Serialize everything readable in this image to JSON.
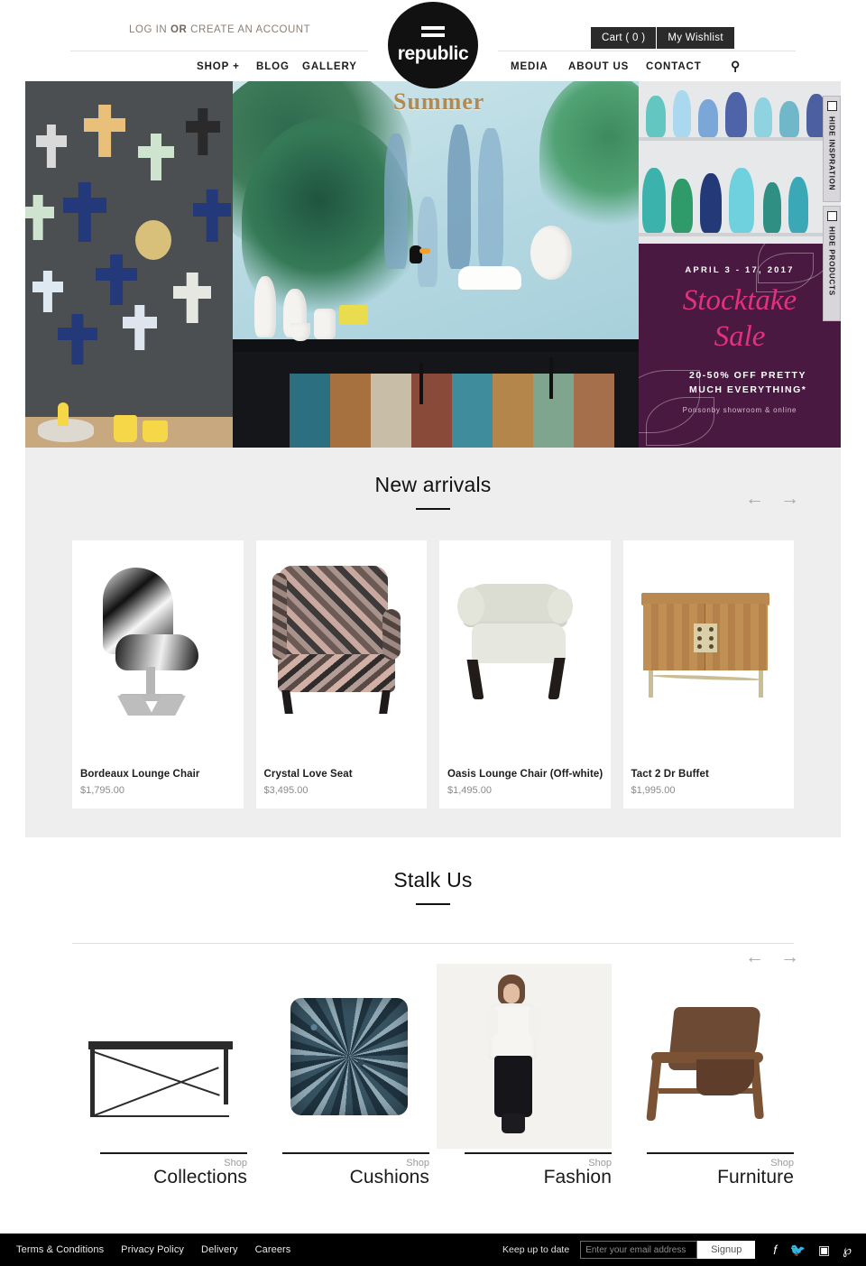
{
  "header": {
    "account": {
      "login": "LOG IN",
      "or": " OR ",
      "create": "CREATE AN ACCOUNT"
    },
    "cart_label": "Cart ( 0 )",
    "wishlist_label": "My Wishlist",
    "logo": {
      "word": "republic",
      "icon": "equals-icon"
    },
    "nav_left": [
      {
        "label": "SHOP +",
        "name": "nav-shop"
      },
      {
        "label": "BLOG",
        "name": "nav-blog"
      },
      {
        "label": "GALLERY",
        "name": "nav-gallery"
      }
    ],
    "nav_right": [
      {
        "label": "MEDIA",
        "name": "nav-media"
      },
      {
        "label": "ABOUT US",
        "name": "nav-about-us"
      },
      {
        "label": "CONTACT",
        "name": "nav-contact"
      }
    ],
    "search_icon": "search-icon"
  },
  "hero": {
    "summer_sign": "Summer",
    "sale": {
      "date": "APRIL 3 - 17, 2017",
      "word1": "Stocktake",
      "word2": "Sale",
      "offer": "20-50% OFF PRETTY\nMUCH EVERYTHING*",
      "offer_line1": "20-50% OFF PRETTY",
      "offer_line2": "MUCH EVERYTHING*",
      "location": "Ponsonby showroom & online"
    },
    "toggles": [
      {
        "label": "HIDE INSPRATION",
        "name": "hide-inspiration"
      },
      {
        "label": "HIDE PRODUCTS",
        "name": "hide-products"
      }
    ]
  },
  "new_arrivals": {
    "title": "New arrivals",
    "prev_arrow": "←",
    "next_arrow": "→",
    "products": [
      {
        "name": "Bordeaux Lounge Chair",
        "price": "$1,795.00"
      },
      {
        "name": "Crystal Love Seat",
        "price": "$3,495.00"
      },
      {
        "name": "Oasis Lounge Chair (Off-white)",
        "price": "$1,495.00"
      },
      {
        "name": "Tact 2 Dr Buffet",
        "price": "$1,995.00"
      }
    ]
  },
  "stalk_us": {
    "title": "Stalk Us",
    "prev_arrow": "←",
    "next_arrow": "→",
    "categories": [
      {
        "shop": "Shop",
        "name": "Collections"
      },
      {
        "shop": "Shop",
        "name": "Cushions"
      },
      {
        "shop": "Shop",
        "name": "Fashion"
      },
      {
        "shop": "Shop",
        "name": "Furniture"
      }
    ]
  },
  "footer": {
    "links": [
      {
        "label": "Terms & Conditions",
        "name": "footer-terms"
      },
      {
        "label": "Privacy Policy",
        "name": "footer-privacy"
      },
      {
        "label": "Delivery",
        "name": "footer-delivery"
      },
      {
        "label": "Careers",
        "name": "footer-careers"
      }
    ],
    "keep_up": "Keep up to date",
    "email_placeholder": "Enter your email address",
    "email_value": "",
    "signup_label": "Signup",
    "socials": [
      {
        "glyph": "f",
        "name": "facebook-icon"
      },
      {
        "glyph": "ᵛ",
        "name": "twitter-icon"
      },
      {
        "glyph": "▣",
        "name": "instagram-icon"
      },
      {
        "glyph": "℗",
        "name": "pinterest-icon"
      }
    ]
  },
  "colors": {
    "sale_purple": "#4a1942",
    "sale_pink": "#e1327d",
    "section_grey": "#eeeeee",
    "footer_black": "#000000"
  }
}
